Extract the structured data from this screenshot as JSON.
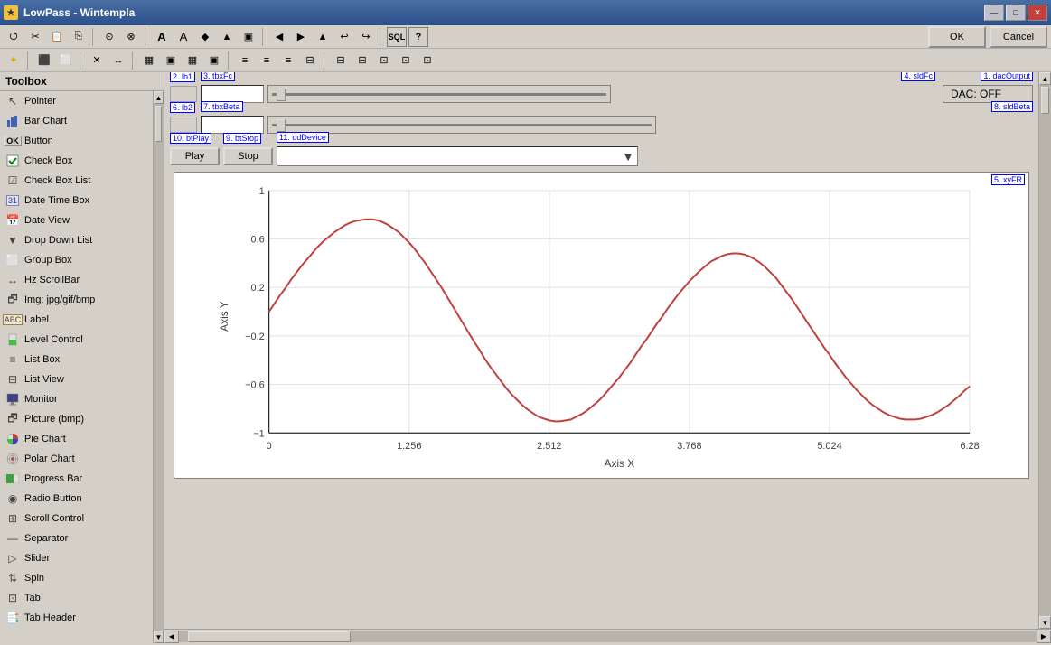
{
  "app": {
    "title": "LowPass  -  Wintempla",
    "icon": "★"
  },
  "title_buttons": {
    "minimize": "—",
    "maximize": "□",
    "close": "✕"
  },
  "action_buttons": {
    "ok": "OK",
    "cancel": "Cancel"
  },
  "toolbox": {
    "header": "Toolbox",
    "items": [
      {
        "id": "pointer",
        "label": "Pointer",
        "icon": "pointer"
      },
      {
        "id": "bar-chart",
        "label": "Bar Chart",
        "icon": "barchart"
      },
      {
        "id": "button",
        "label": "Button",
        "icon": "button"
      },
      {
        "id": "check-box",
        "label": "Check Box",
        "icon": "check"
      },
      {
        "id": "check-box-list",
        "label": "Check Box List",
        "icon": "checklist"
      },
      {
        "id": "date-time-box",
        "label": "Date Time Box",
        "icon": "datetime"
      },
      {
        "id": "date-view",
        "label": "Date View",
        "icon": "dateview"
      },
      {
        "id": "drop-down-list",
        "label": "Drop Down List",
        "icon": "dropdown"
      },
      {
        "id": "group-box",
        "label": "Group Box",
        "icon": "group"
      },
      {
        "id": "hz-scrollbar",
        "label": "Hz ScrollBar",
        "icon": "hzscroll"
      },
      {
        "id": "img",
        "label": "Img: jpg/gif/bmp",
        "icon": "img"
      },
      {
        "id": "label",
        "label": "Label",
        "icon": "label"
      },
      {
        "id": "level-control",
        "label": "Level Control",
        "icon": "level"
      },
      {
        "id": "list-box",
        "label": "List Box",
        "icon": "listbox"
      },
      {
        "id": "list-view",
        "label": "List View",
        "icon": "listview"
      },
      {
        "id": "monitor",
        "label": "Monitor",
        "icon": "monitor"
      },
      {
        "id": "picture",
        "label": "Picture (bmp)",
        "icon": "picture"
      },
      {
        "id": "pie-chart",
        "label": "Pie Chart",
        "icon": "pie"
      },
      {
        "id": "polar-chart",
        "label": "Polar Chart",
        "icon": "polar"
      },
      {
        "id": "progress-bar",
        "label": "Progress Bar",
        "icon": "progress"
      },
      {
        "id": "radio-button",
        "label": "Radio Button",
        "icon": "radio"
      },
      {
        "id": "scroll-control",
        "label": "Scroll Control",
        "icon": "scroll"
      },
      {
        "id": "separator",
        "label": "Separator",
        "icon": "separator"
      },
      {
        "id": "slider",
        "label": "Slider",
        "icon": "slider"
      },
      {
        "id": "spin",
        "label": "Spin",
        "icon": "spin"
      },
      {
        "id": "tab",
        "label": "Tab",
        "icon": "tab"
      },
      {
        "id": "tab-header",
        "label": "Tab Header",
        "icon": "tabheader"
      }
    ]
  },
  "canvas": {
    "widgets": {
      "lb1_tag": "2. lb1",
      "tbxFc_tag": "3. tbxFc",
      "sldFc_tag": "4. sldFc",
      "dacOutput_tag": "1. dacOutput",
      "dac_text": "DAC: OFF",
      "lb2_tag": "6. lb2",
      "tbxBeta_tag": "7. tbxBeta",
      "sldBeta_tag": "8. sldBeta",
      "btPlay_tag": "10. btPlay",
      "btStop_tag": "9. btStop",
      "ddDevice_tag": "11. ddDevice",
      "play_label": "Play",
      "stop_label": "Stop",
      "xyFR_tag": "5. xyFR"
    }
  },
  "chart": {
    "x_axis_label": "Axis X",
    "y_axis_label": "Axis Y",
    "x_ticks": [
      "0",
      "1.256",
      "2.512",
      "3.768",
      "5.024",
      "6.28"
    ],
    "y_ticks": [
      "1",
      "0.6",
      "0.2",
      "-0.2",
      "-0.6",
      "-1"
    ],
    "y_tick_values": [
      1,
      0.6,
      0.2,
      -0.2,
      -0.6,
      -1
    ]
  },
  "toolbar": {
    "row1_icons": [
      "⭯",
      "✂",
      "📋",
      "⎘",
      "🔗",
      "◉",
      "A",
      "A",
      "◆",
      "▲",
      "▣",
      "◀",
      "▶",
      "⬆",
      "↩",
      "↩",
      "↪",
      "SQL",
      "?"
    ],
    "row2_icons": [
      "✦",
      "⬛",
      "⬜",
      "✕",
      "↔",
      "↕",
      "▦",
      "▣",
      "≡",
      "≡",
      "≡",
      "≡",
      "≡",
      "≡",
      "≡",
      "≡",
      "≡",
      "≡",
      "≡",
      "⊟",
      "⊟",
      "⊟",
      "⊡",
      "⊡",
      "⊡"
    ]
  }
}
